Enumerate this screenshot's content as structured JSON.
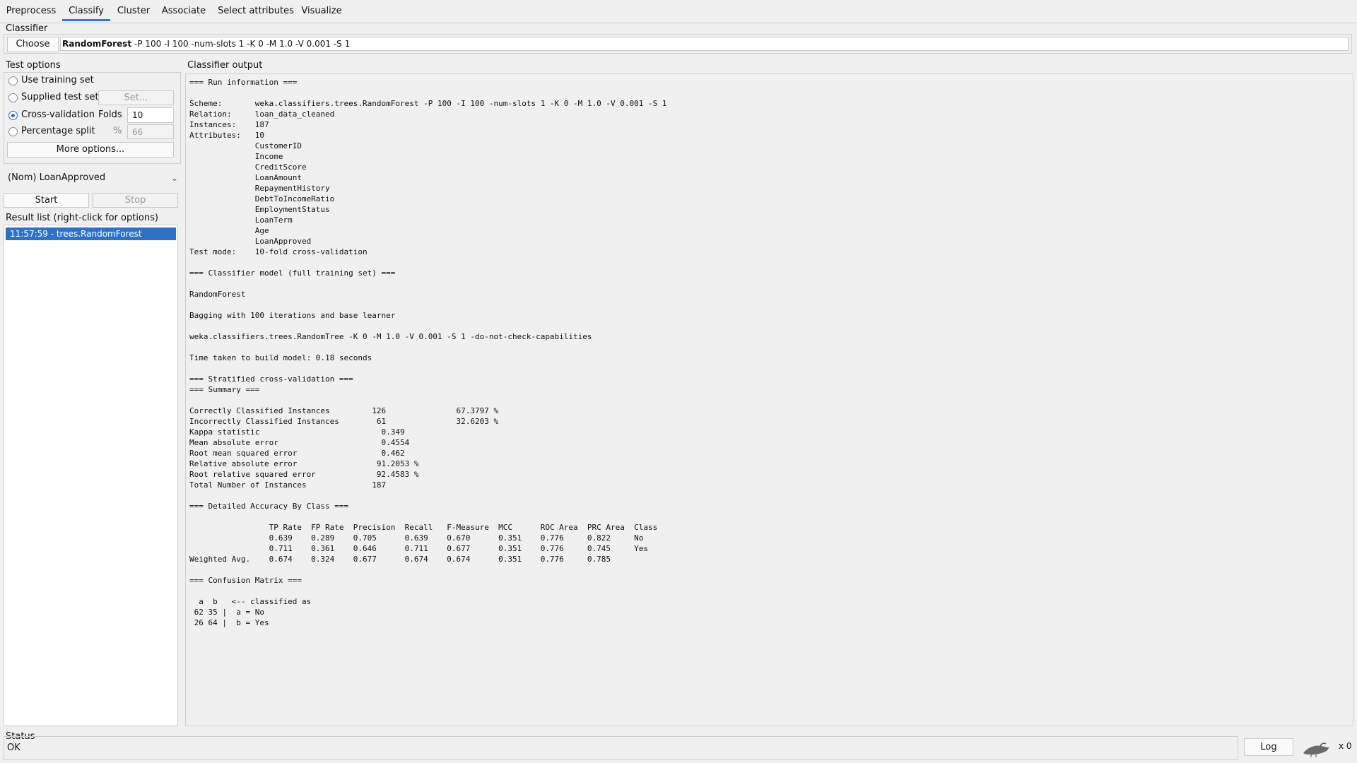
{
  "tabs": [
    "Preprocess",
    "Classify",
    "Cluster",
    "Associate",
    "Select attributes",
    "Visualize"
  ],
  "classifier": {
    "section_title": "Classifier",
    "choose_label": "Choose",
    "name": "RandomForest",
    "options": " -P 100 -I 100 -num-slots 1 -K 0 -M 1.0 -V 0.001 -S 1"
  },
  "test_options": {
    "title": "Test options",
    "use_training": "Use training set",
    "supplied": "Supplied test set",
    "set_label": "Set...",
    "cross_validation": "Cross-validation",
    "folds_label": "Folds",
    "folds_value": "10",
    "percentage_split": "Percentage split",
    "percent_symbol": "%",
    "percent_value": "66",
    "more_options": "More options...",
    "selected": "Cross-validation"
  },
  "class_select": "(Nom) LoanApproved",
  "start_label": "Start",
  "stop_label": "Stop",
  "result_list": {
    "title": "Result list (right-click for options)",
    "items": [
      "11:57:59 - trees.RandomForest"
    ]
  },
  "output": {
    "title": "Classifier output",
    "lines": [
      "=== Run information ===",
      "",
      "Scheme:       weka.classifiers.trees.RandomForest -P 100 -I 100 -num-slots 1 -K 0 -M 1.0 -V 0.001 -S 1",
      "Relation:     loan_data_cleaned",
      "Instances:    187",
      "Attributes:   10",
      "              CustomerID",
      "              Income",
      "              CreditScore",
      "              LoanAmount",
      "              RepaymentHistory",
      "              DebtToIncomeRatio",
      "              EmploymentStatus",
      "              LoanTerm",
      "              Age",
      "              LoanApproved",
      "Test mode:    10-fold cross-validation",
      "",
      "=== Classifier model (full training set) ===",
      "",
      "RandomForest",
      "",
      "Bagging with 100 iterations and base learner",
      "",
      "weka.classifiers.trees.RandomTree -K 0 -M 1.0 -V 0.001 -S 1 -do-not-check-capabilities",
      "",
      "Time taken to build model: 0.18 seconds",
      "",
      "=== Stratified cross-validation ===",
      "=== Summary ===",
      "",
      "Correctly Classified Instances         126               67.3797 %",
      "Incorrectly Classified Instances        61               32.6203 %",
      "Kappa statistic                          0.349",
      "Mean absolute error                      0.4554",
      "Root mean squared error                  0.462",
      "Relative absolute error                 91.2053 %",
      "Root relative squared error             92.4583 %",
      "Total Number of Instances              187",
      "",
      "=== Detailed Accuracy By Class ===",
      "",
      "                 TP Rate  FP Rate  Precision  Recall   F-Measure  MCC      ROC Area  PRC Area  Class",
      "                 0.639    0.289    0.705      0.639    0.670      0.351    0.776     0.822     No",
      "                 0.711    0.361    0.646      0.711    0.677      0.351    0.776     0.745     Yes",
      "Weighted Avg.    0.674    0.324    0.677      0.674    0.674      0.351    0.776     0.785",
      "",
      "=== Confusion Matrix ===",
      "",
      "  a  b   <-- classified as",
      " 62 35 |  a = No",
      " 26 64 |  b = Yes"
    ]
  },
  "status": {
    "title": "Status",
    "text": "OK",
    "log_label": "Log",
    "count": "x 0"
  },
  "colors": {
    "accent": "#3a78c5",
    "selection": "#2e72c8"
  }
}
